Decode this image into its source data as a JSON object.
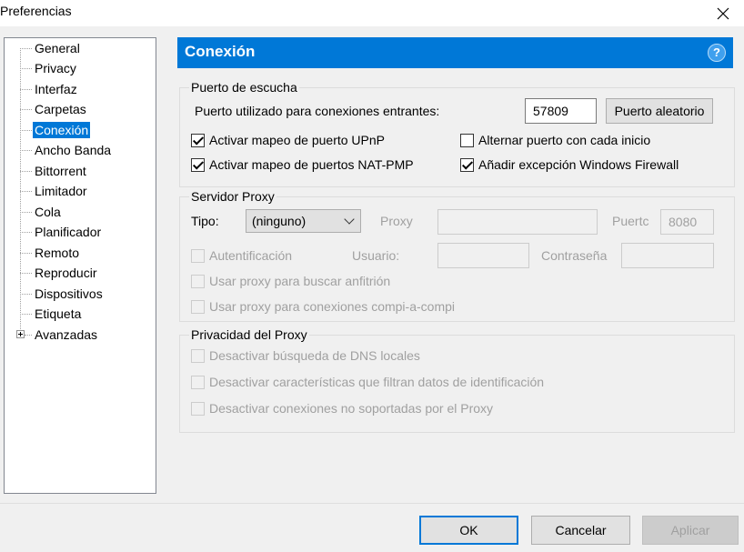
{
  "window": {
    "title": "Preferencias",
    "close_icon": "close-icon"
  },
  "sidebar": {
    "items": [
      {
        "label": "General"
      },
      {
        "label": "Privacy"
      },
      {
        "label": "Interfaz"
      },
      {
        "label": "Carpetas"
      },
      {
        "label": "Conexión",
        "selected": true
      },
      {
        "label": "Ancho Banda"
      },
      {
        "label": "Bittorrent"
      },
      {
        "label": "Limitador"
      },
      {
        "label": "Cola"
      },
      {
        "label": "Planificador"
      },
      {
        "label": "Remoto"
      },
      {
        "label": "Reproducir"
      },
      {
        "label": "Dispositivos"
      },
      {
        "label": "Etiqueta"
      },
      {
        "label": "Avanzadas",
        "expandable": true
      }
    ]
  },
  "header": {
    "title": "Conexión",
    "help_icon": "?",
    "accent": "#0078d7"
  },
  "listen_port": {
    "group_title": "Puerto de escucha",
    "incoming_label": "Puerto utilizado para conexiones entrantes:",
    "port_value": "57809",
    "random_button": "Puerto aleatorio",
    "upnp": {
      "label": "Activar mapeo de puerto UPnP",
      "checked": true
    },
    "natpmp": {
      "label": "Activar mapeo de puertos NAT-PMP",
      "checked": true
    },
    "alternate": {
      "label": "Alternar puerto con cada inicio",
      "checked": false
    },
    "firewall": {
      "label": "Añadir excepción Windows Firewall",
      "checked": true
    }
  },
  "proxy": {
    "group_title": "Servidor Proxy",
    "type_label": "Tipo:",
    "type_value": "(ninguno)",
    "proxy_label": "Proxy",
    "proxy_value": "",
    "port_label": "Puertc",
    "port_value": "8080",
    "auth": {
      "label": "Autentificación",
      "checked": false
    },
    "user_label": "Usuario:",
    "user_value": "",
    "password_label": "Contraseña",
    "password_value": "",
    "hostname": {
      "label": "Usar proxy para buscar anfitrión",
      "checked": false
    },
    "p2p": {
      "label": "Usar proxy para conexiones compi-a-compi",
      "checked": false
    }
  },
  "privacy": {
    "group_title": "Privacidad del Proxy",
    "dns": {
      "label": "Desactivar búsqueda de DNS locales",
      "checked": false
    },
    "features": {
      "label": "Desactivar características que filtran datos de identificación",
      "checked": false
    },
    "unsupported": {
      "label": "Desactivar conexiones no soportadas por el Proxy",
      "checked": false
    }
  },
  "footer": {
    "ok": "OK",
    "cancel": "Cancelar",
    "apply": "Aplicar"
  }
}
